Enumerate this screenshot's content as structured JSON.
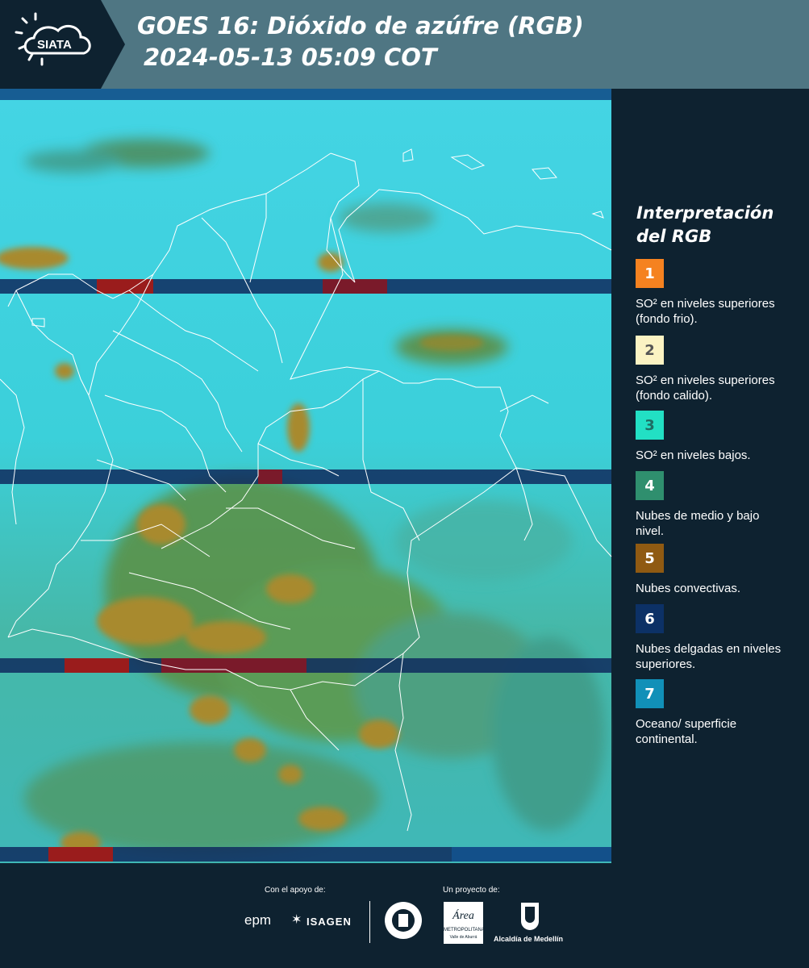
{
  "header": {
    "logo_text": "SIATA",
    "title_line1": "GOES 16: Dióxido de azúfre (RGB)",
    "title_line2": "2024-05-13 05:09 COT"
  },
  "map": {
    "product": "GOES 16 SO2 RGB composite",
    "colors": {
      "base": "#3ed6e0",
      "land_green": "#5f8c3c",
      "convective": "#a88a2e",
      "stripe_dark": "#0f2a5e",
      "stripe_red": "#9a1c1c",
      "borders": "#ffffff"
    }
  },
  "legend": {
    "title": "Interpretación del RGB",
    "items": [
      {
        "number": "1",
        "color": "#f58220",
        "num_color": "#ffffff",
        "description": "SO² en niveles superiores (fondo frio)."
      },
      {
        "number": "2",
        "color": "#fbf3c3",
        "num_color": "#555555",
        "description": "SO² en niveles superiores (fondo calido)."
      },
      {
        "number": "3",
        "color": "#22e0c4",
        "num_color": "#1e6e64",
        "description": "SO² en niveles bajos."
      },
      {
        "number": "4",
        "color": "#2f8f6e",
        "num_color": "#ffffff",
        "description": "Nubes de medio y bajo nivel."
      },
      {
        "number": "5",
        "color": "#8f5a12",
        "num_color": "#ffffff",
        "description": "Nubes convectivas."
      },
      {
        "number": "6",
        "color": "#0c3166",
        "num_color": "#ffffff",
        "description": "Nubes delgadas en niveles superiores."
      },
      {
        "number": "7",
        "color": "#1190b8",
        "num_color": "#ffffff",
        "description": "Oceano/ superficie continental."
      }
    ]
  },
  "footer": {
    "support_caption": "Con el apoyo de:",
    "project_caption": "Un proyecto de:",
    "sponsor_epm": "epm",
    "sponsor_isagen": "ISAGEN",
    "area_metropolitana": "Área",
    "area_sub": "METROPOLITANA",
    "area_sub2": "Valle de Aburrá",
    "alcaldia": "Alcaldía de Medellín"
  }
}
